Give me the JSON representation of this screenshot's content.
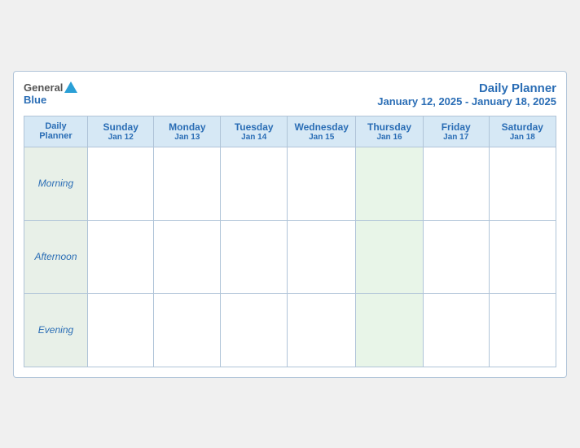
{
  "header": {
    "logo": {
      "general": "General",
      "blue": "Blue"
    },
    "title": "Daily Planner",
    "subtitle": "January 12, 2025 - January 18, 2025"
  },
  "grid": {
    "label_col": {
      "main": "Daily",
      "sub": "Planner"
    },
    "days": [
      {
        "name": "Sunday",
        "date": "Jan 12"
      },
      {
        "name": "Monday",
        "date": "Jan 13"
      },
      {
        "name": "Tuesday",
        "date": "Jan 14"
      },
      {
        "name": "Wednesday",
        "date": "Jan 15"
      },
      {
        "name": "Thursday",
        "date": "Jan 16"
      },
      {
        "name": "Friday",
        "date": "Jan 17"
      },
      {
        "name": "Saturday",
        "date": "Jan 18"
      }
    ],
    "rows": [
      {
        "label": "Morning"
      },
      {
        "label": "Afternoon"
      },
      {
        "label": "Evening"
      }
    ]
  }
}
